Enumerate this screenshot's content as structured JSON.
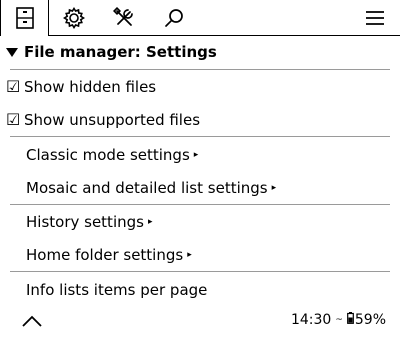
{
  "tabs": [
    {
      "icon": "file-cabinet-icon",
      "active": true
    },
    {
      "icon": "gear-icon",
      "active": false
    },
    {
      "icon": "tools-icon",
      "active": false
    },
    {
      "icon": "search-icon",
      "active": false
    },
    {
      "icon": "hamburger-menu-icon",
      "active": false
    }
  ],
  "menu": {
    "title": "File manager: Settings",
    "items": [
      {
        "label": "Show hidden files",
        "checked": true,
        "check_glyph": "☑"
      },
      {
        "label": "Show unsupported files",
        "checked": true,
        "check_glyph": "☑"
      },
      {
        "label": "Classic mode settings",
        "submenu_glyph": "▸"
      },
      {
        "label": "Mosaic and detailed list settings",
        "submenu_glyph": "▸"
      },
      {
        "label": "History settings",
        "submenu_glyph": "▸"
      },
      {
        "label": "Home folder settings",
        "submenu_glyph": "▸"
      },
      {
        "label": "Info lists items per page"
      }
    ]
  },
  "footer": {
    "time": "14:30",
    "battery_prefix": "~",
    "battery": "59%"
  }
}
